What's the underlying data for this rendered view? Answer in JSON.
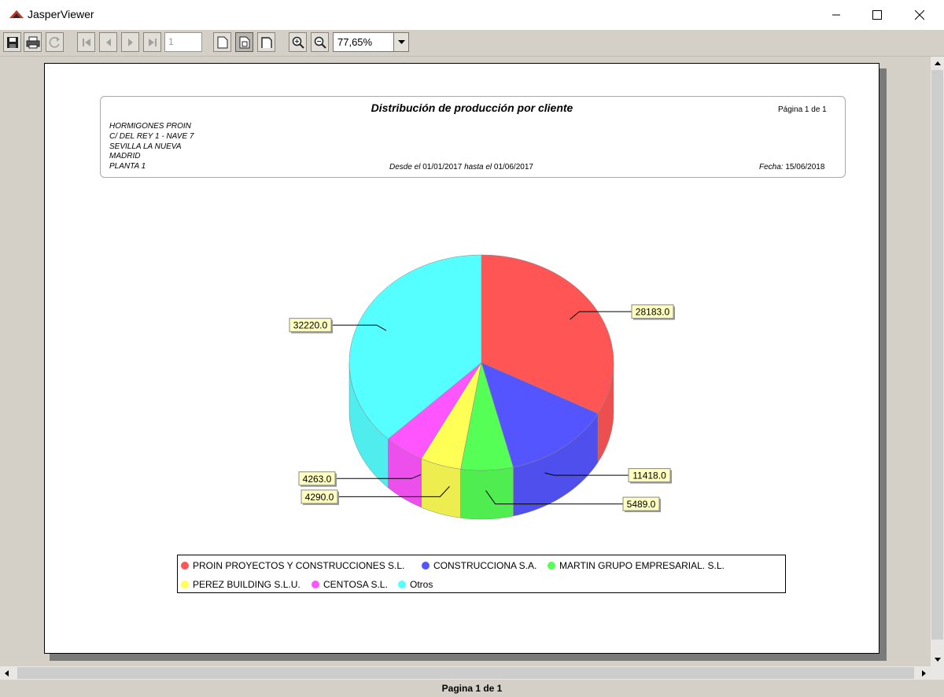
{
  "window": {
    "title": "JasperViewer"
  },
  "toolbar": {
    "page_number": "1",
    "zoom": "77,65%"
  },
  "status": {
    "text": "Pagina 1 de 1"
  },
  "report": {
    "title": "Distribución de producción por cliente",
    "page_info": "Página 1 de 1",
    "company": [
      "HORMIGONES PROIN",
      "C/ DEL REY 1 - NAVE 7",
      "SEVILLA LA NUEVA",
      "MADRID",
      "PLANTA 1"
    ],
    "desde_label": "Desde el",
    "desde_value": "01/01/2017",
    "hasta_label": "hasta el",
    "hasta_value": "01/06/2017",
    "fecha_label": "Fecha:",
    "fecha_value": "15/06/2018"
  },
  "chart_data": {
    "type": "pie",
    "categories": [
      "PROIN PROYECTOS Y CONSTRUCCIONES S.L.",
      "CONSTRUCCIONA S.A.",
      "MARTIN GRUPO EMPRESARIAL. S.L.",
      "PEREZ BUILDING S.L.U.",
      "CENTOSA S.L.",
      "Otros"
    ],
    "values": [
      28183.0,
      11418.0,
      5489.0,
      4290.0,
      4263.0,
      32220.0
    ],
    "labels": [
      "28183.0",
      "11418.0",
      "5489.0",
      "4290.0",
      "4263.0",
      "32220.0"
    ],
    "colors": [
      "#ff5555",
      "#5555ff",
      "#55ff55",
      "#ffff55",
      "#ff55ff",
      "#55ffff"
    ],
    "legend_position": "bottom"
  }
}
